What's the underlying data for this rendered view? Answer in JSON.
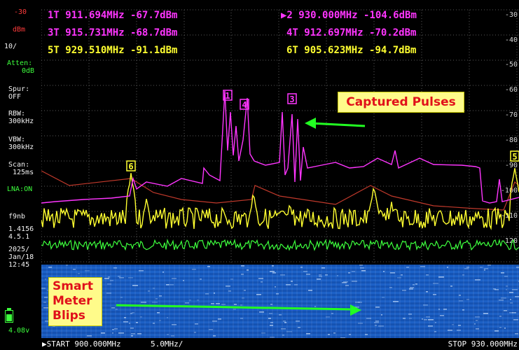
{
  "markers": [
    {
      "id": "1T",
      "freq": "911.694MHz",
      "level": "-67.7dBm",
      "color": "#ff35ff"
    },
    {
      "id": "▶2",
      "freq": "930.000MHz",
      "level": "-104.6dBm",
      "color": "#ff35ff"
    },
    {
      "id": "3T",
      "freq": "915.731MHz",
      "level": "-68.7dBm",
      "color": "#ff35ff"
    },
    {
      "id": "4T",
      "freq": "912.697MHz",
      "level": "-70.2dBm",
      "color": "#ff35ff"
    },
    {
      "id": "5T",
      "freq": "929.510MHz",
      "level": "-91.1dBm",
      "color": "#ffff30"
    },
    {
      "id": "6T",
      "freq": "905.623MHz",
      "level": "-94.7dBm",
      "color": "#ffff30"
    }
  ],
  "sidebar": {
    "ref_level": "-30",
    "ref_unit": "dBm",
    "scale": "10/",
    "atten_label": "Atten:",
    "atten_value": "0dB",
    "spur_label": "Spur:",
    "spur_value": "OFF",
    "rbw_label": "RBW:",
    "rbw_value": "300kHz",
    "vbw_label": "VBW:",
    "vbw_value": "300kHz",
    "scan_label": "Scan:",
    "scan_value": "125ms",
    "lna": "LNA:ON",
    "mode": "f9nb",
    "fw1": "1.4156",
    "fw2": "4.5.1",
    "date1": "2025/",
    "date2": "Jan/18",
    "time": "12:45",
    "battery_v": "4.08v"
  },
  "right_scale": [
    "-30",
    "-40",
    "-50",
    "-60",
    "-70",
    "-80",
    "-90",
    "-100",
    "-110",
    "-120"
  ],
  "marker_flags": [
    {
      "label": "1",
      "color": "#ff35ff"
    },
    {
      "label": "4",
      "color": "#ff35ff"
    },
    {
      "label": "3",
      "color": "#ff35ff"
    },
    {
      "label": "6",
      "color": "#ffff30"
    },
    {
      "label": "5",
      "color": "#ffff30"
    }
  ],
  "annotations": {
    "captured": "Captured Pulses",
    "smart_1": "Smart",
    "smart_2": "Meter",
    "smart_3": "Blips"
  },
  "status": {
    "start": "▶START 900.000MHz",
    "span": "5.0MHz/",
    "stop": "STOP 930.000MHz"
  },
  "colors": {
    "trace_max": "#ff35ff",
    "trace_live": "#ffff30",
    "trace_min": "#3dff3d",
    "trace_avg": "#c0392b",
    "annot_arrow": "#22ff22",
    "waterfall": "#1c62c9"
  },
  "icons": {
    "battery": "battery-icon"
  }
}
